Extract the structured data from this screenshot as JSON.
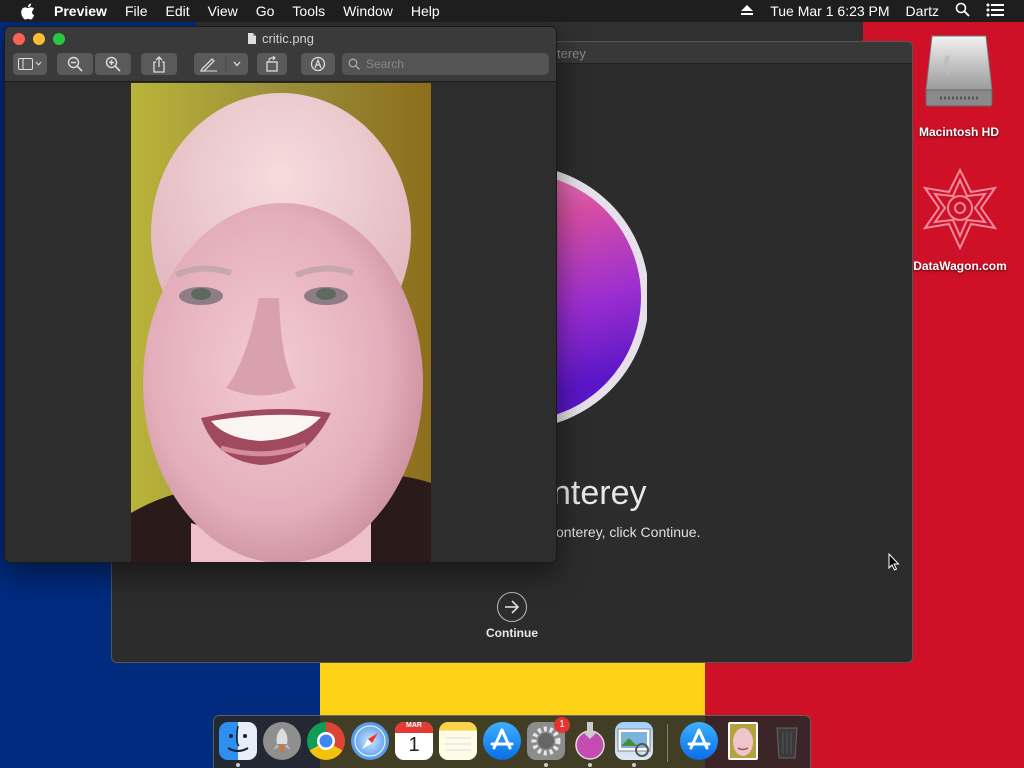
{
  "menubar": {
    "app_name": "Preview",
    "items": [
      "File",
      "Edit",
      "View",
      "Go",
      "Tools",
      "Window",
      "Help"
    ],
    "datetime": "Tue Mar 1  6:23 PM",
    "user": "Dartz"
  },
  "desktop": {
    "icons": [
      {
        "label": "Macintosh HD"
      },
      {
        "label": "DataWagon.com"
      }
    ],
    "flag_colors": {
      "blue": "#002b7f",
      "yellow": "#fcd116",
      "red": "#ce1126"
    }
  },
  "preview_window": {
    "title": "critic.png",
    "search_placeholder": "Search"
  },
  "installer_window": {
    "title_fragment": "terey",
    "heading_fragment": "nterey",
    "subtitle_fragment": "onterey, click Continue.",
    "continue_label": "Continue"
  },
  "dock": {
    "apps": [
      {
        "icon": "finder-icon"
      },
      {
        "icon": "launchpad-icon"
      },
      {
        "icon": "chrome-icon"
      },
      {
        "icon": "safari-icon"
      },
      {
        "icon": "calendar-icon",
        "month": "MAR",
        "day": "1"
      },
      {
        "icon": "notes-icon"
      },
      {
        "icon": "app-store-icon"
      },
      {
        "icon": "system-preferences-icon",
        "badge": "1"
      },
      {
        "icon": "install-macos-monterey-icon"
      },
      {
        "icon": "preview-icon"
      },
      {
        "icon": "app-store-downloads-icon"
      },
      {
        "icon": "critic-image-icon"
      },
      {
        "icon": "trash-icon"
      }
    ]
  }
}
